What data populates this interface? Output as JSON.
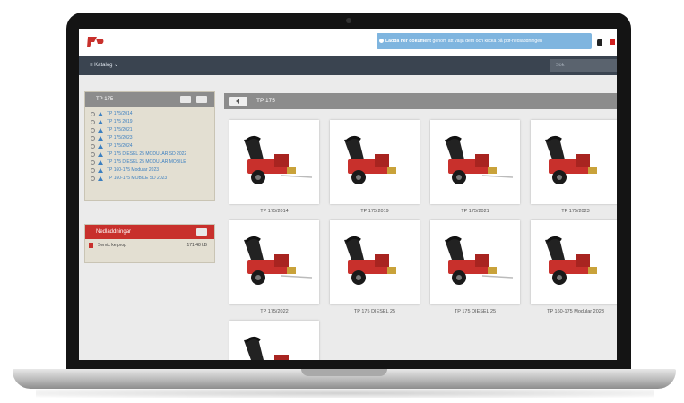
{
  "topbar": {
    "notice": {
      "bold_prefix": "Ladda ner dokument",
      "text": "genom att välja dem och klicka på pdf-nedladdningen"
    }
  },
  "navbar": {
    "catalog_label": "≡ Katalog ⌄",
    "search_placeholder": "Sök"
  },
  "tree_panel": {
    "title": "TP 175",
    "items": [
      "TP 175/2014",
      "TP 175 2019",
      "TP 175/2021",
      "TP 175/2023",
      "TP 175/2024",
      "TP 175 DIESEL 25 MODULAR SD 2022",
      "TP 175 DIESEL 25 MODULAR MOBILE",
      "TP 160-175 Modular 2023",
      "TP 160-175 MOBILE SD 2023"
    ]
  },
  "favorites_panel": {
    "title": "Nedladdningar",
    "rows": [
      {
        "name": "Servic ke.prop",
        "size": "171.48 kB"
      }
    ]
  },
  "main": {
    "title": "TP 175",
    "products": [
      {
        "label": "TP 175/2014"
      },
      {
        "label": "TP 175 2019"
      },
      {
        "label": "TP 175/2021"
      },
      {
        "label": "TP 175/2023"
      },
      {
        "label": "TP 175/2022"
      },
      {
        "label": "TP 175 DIESEL 25"
      },
      {
        "label": "TP 175 DIESEL 25"
      },
      {
        "label": "TP 160-175 Modular 2023"
      },
      {
        "label": ""
      }
    ]
  },
  "colors": {
    "brand_red": "#c8302c",
    "nav_dark": "#3a4450",
    "notice_blue": "#7fb5df",
    "link_blue": "#3b7fc0"
  }
}
